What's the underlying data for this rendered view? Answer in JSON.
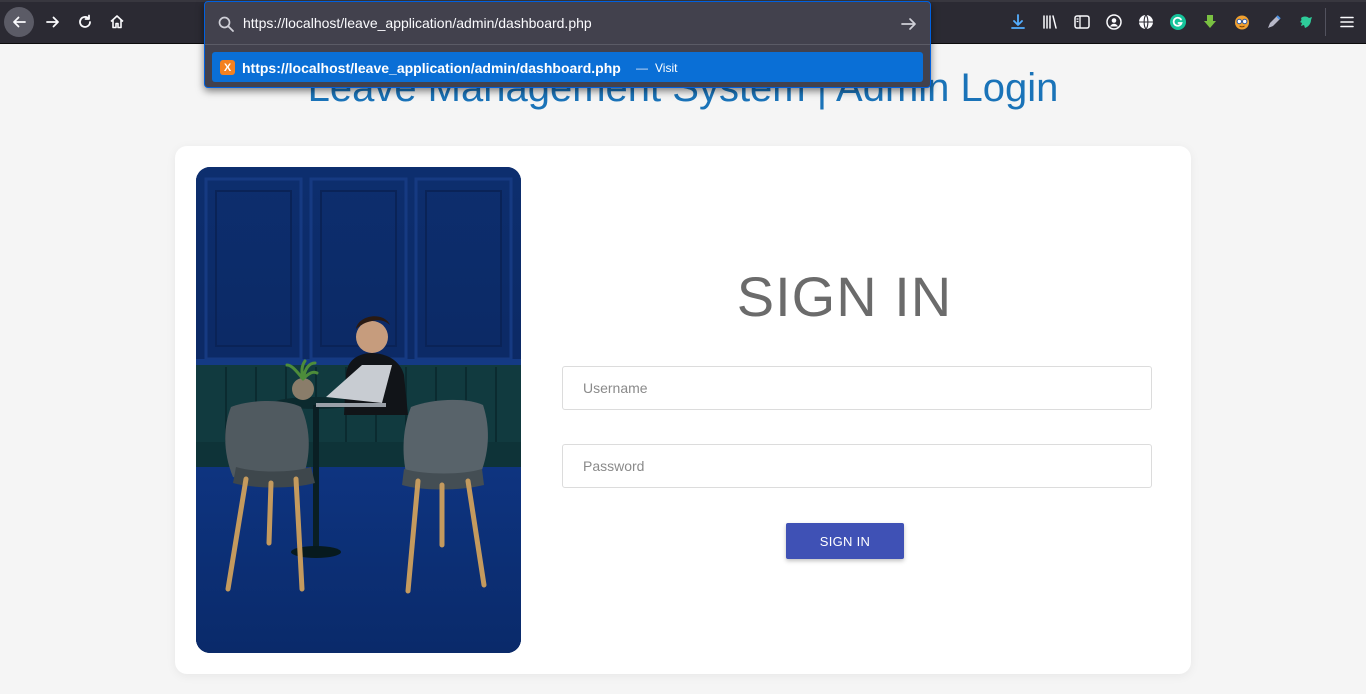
{
  "browser": {
    "address_value": "https://localhost/leave_application/admin/dashboard.php",
    "suggestion": {
      "url": "https://localhost/leave_application/admin/dashboard.php",
      "separator": "—",
      "action": "Visit",
      "favicon_glyph": "X"
    },
    "toolbar_icons": [
      "download-icon",
      "library-icon",
      "sidebar-icon",
      "account-icon",
      "globe-icon",
      "grammarly-icon",
      "download-helper-icon",
      "extension-face-icon",
      "pen-tool-icon",
      "bird-extension-icon",
      "menu-icon"
    ],
    "accent_color": "#0a6fd6"
  },
  "page": {
    "heading": "Leave Management System | Admin Login",
    "heading_color": "#1a73b8"
  },
  "login": {
    "title": "SIGN IN",
    "username_placeholder": "Username",
    "password_placeholder": "Password",
    "submit_label": "SIGN IN",
    "button_color": "#3f51b5"
  }
}
